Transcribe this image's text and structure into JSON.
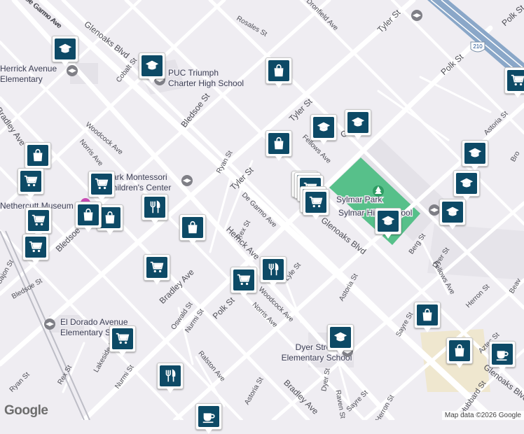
{
  "map": {
    "streets": [
      {
        "id": "glenoaks-1",
        "text": "Glenoaks Blvd"
      },
      {
        "id": "glenoaks-2",
        "text": "Glenoaks Blvd"
      },
      {
        "id": "glenoaks-3",
        "text": "Glenoaks Blvd"
      },
      {
        "id": "tyler-1",
        "text": "Tyler St"
      },
      {
        "id": "tyler-2",
        "text": "Tyler St"
      },
      {
        "id": "tyler-3",
        "text": "Tyler St"
      },
      {
        "id": "polk-1",
        "text": "Polk St"
      },
      {
        "id": "polk-2",
        "text": "Polk St"
      },
      {
        "id": "polk-3",
        "text": "Polk St"
      },
      {
        "id": "bradley-1",
        "text": "Bradley Ave"
      },
      {
        "id": "bradley-2",
        "text": "Bradley Ave"
      },
      {
        "id": "bradley-3",
        "text": "Bradley Ave"
      },
      {
        "id": "bledsoe-1",
        "text": "Bledsoe St"
      },
      {
        "id": "bledsoe-2",
        "text": "Bledsoe St"
      },
      {
        "id": "bledsoe-3",
        "text": "Bledsoe St"
      },
      {
        "id": "herrick",
        "text": "Herrick Ave"
      },
      {
        "id": "woodcock-1",
        "text": "Woodcock Ave"
      },
      {
        "id": "woodcock-2",
        "text": "Woodcock Ave"
      },
      {
        "id": "norris-1",
        "text": "Norris Ave"
      },
      {
        "id": "norris-2",
        "text": "Norris Ave"
      },
      {
        "id": "degarmo-1",
        "text": "De Garmo Ave"
      },
      {
        "id": "degarmo-2",
        "text": "De Garmo Ave"
      },
      {
        "id": "rosales",
        "text": "Rosales St"
      },
      {
        "id": "dronfield",
        "text": "Dronfield Ave"
      },
      {
        "id": "cobalt",
        "text": "Cobalt St"
      },
      {
        "id": "ryan-1",
        "text": "Ryan St"
      },
      {
        "id": "ryan-2",
        "text": "Ryan St"
      },
      {
        "id": "rex-1",
        "text": "Rex St"
      },
      {
        "id": "rex-2",
        "text": "Rex St"
      },
      {
        "id": "lyle",
        "text": "Lyle St"
      },
      {
        "id": "astoria-1",
        "text": "Astoria St"
      },
      {
        "id": "astoria-2",
        "text": "Astoria St"
      },
      {
        "id": "astoria-3",
        "text": "Astoria St"
      },
      {
        "id": "fellows-1",
        "text": "Fellows Ave"
      },
      {
        "id": "fellows-2",
        "text": "Fellows Ave"
      },
      {
        "id": "berg",
        "text": "Berg St"
      },
      {
        "id": "dyer-1",
        "text": "Dyer St"
      },
      {
        "id": "dyer-2",
        "text": "Dyer St"
      },
      {
        "id": "herron-1",
        "text": "Herron St"
      },
      {
        "id": "herron-2",
        "text": "Herron St"
      },
      {
        "id": "sayre-1",
        "text": "Sayre St"
      },
      {
        "id": "sayre-2",
        "text": "Sayre St"
      },
      {
        "id": "aztec",
        "text": "Aztec St"
      },
      {
        "id": "hubbard",
        "text": "Hubbard St"
      },
      {
        "id": "oswald",
        "text": "Oswald St"
      },
      {
        "id": "nurmi-1",
        "text": "Nurmi St"
      },
      {
        "id": "nurmi-2",
        "text": "Nurmi St"
      },
      {
        "id": "ralston",
        "text": "Ralston Ave"
      },
      {
        "id": "lakeside",
        "text": "Lakeside St"
      },
      {
        "id": "raven",
        "text": "Raven St"
      },
      {
        "id": "sajon",
        "text": "Sajon St"
      },
      {
        "id": "beaver",
        "text": "Beav"
      },
      {
        "id": "bro",
        "text": "Bro"
      },
      {
        "id": "garmo-top",
        "text": "de Garmo Ave"
      },
      {
        "id": "glen-right",
        "text": "Glen"
      }
    ],
    "pois": [
      {
        "id": "herrick-elem",
        "lines": [
          "Herrick Avenue",
          "Elementary"
        ]
      },
      {
        "id": "puc-triumph",
        "lines": [
          "PUC Triumph",
          "Charter High School"
        ]
      },
      {
        "id": "montessori",
        "lines": [
          "Park Montessori",
          "Children's Center"
        ]
      },
      {
        "id": "sylmar-park",
        "lines": [
          "Sylmar Park"
        ]
      },
      {
        "id": "sylmar-hs",
        "lines": [
          "Sylmar High School"
        ]
      },
      {
        "id": "eldorado",
        "lines": [
          "El Dorado Avenue",
          "Elementary School"
        ]
      },
      {
        "id": "dyer-elem",
        "lines": [
          "Dyer Street",
          "Elementary School"
        ]
      },
      {
        "id": "museum",
        "lines": [
          "Nethercutt Museum"
        ]
      }
    ],
    "highway_shield": "210",
    "logo": "Google",
    "attribution": "Map data ©2026 Google"
  },
  "markers": [
    {
      "icon": "school-icon"
    },
    {
      "icon": "school-icon"
    },
    {
      "icon": "school-icon"
    },
    {
      "icon": "school-icon"
    },
    {
      "icon": "school-icon"
    },
    {
      "icon": "school-icon"
    },
    {
      "icon": "school-icon"
    },
    {
      "icon": "school-icon"
    },
    {
      "icon": "school-icon"
    },
    {
      "icon": "shopping-bag-icon"
    },
    {
      "icon": "shopping-bag-icon"
    },
    {
      "icon": "shopping-bag-icon"
    },
    {
      "icon": "shopping-bag-icon"
    },
    {
      "icon": "shopping-bag-icon"
    },
    {
      "icon": "shopping-bag-icon"
    },
    {
      "icon": "shopping-bag-icon"
    },
    {
      "icon": "shopping-bag-icon"
    },
    {
      "icon": "shopping-cart-icon"
    },
    {
      "icon": "shopping-cart-icon"
    },
    {
      "icon": "shopping-cart-icon"
    },
    {
      "icon": "shopping-cart-icon"
    },
    {
      "icon": "shopping-cart-icon"
    },
    {
      "icon": "shopping-cart-icon"
    },
    {
      "icon": "shopping-cart-icon"
    },
    {
      "icon": "shopping-cart-icon"
    },
    {
      "icon": "shopping-cart-icon"
    },
    {
      "icon": "restaurant-icon"
    },
    {
      "icon": "restaurant-icon"
    },
    {
      "icon": "restaurant-icon"
    },
    {
      "icon": "coffee-icon"
    },
    {
      "icon": "coffee-icon"
    }
  ],
  "colors": {
    "background": "#efedf2",
    "road": "#ffffff",
    "park": "#57c08a",
    "campus": "#e3e1e6",
    "marker": "#0d4a66",
    "highway": "#8aa7c8"
  }
}
